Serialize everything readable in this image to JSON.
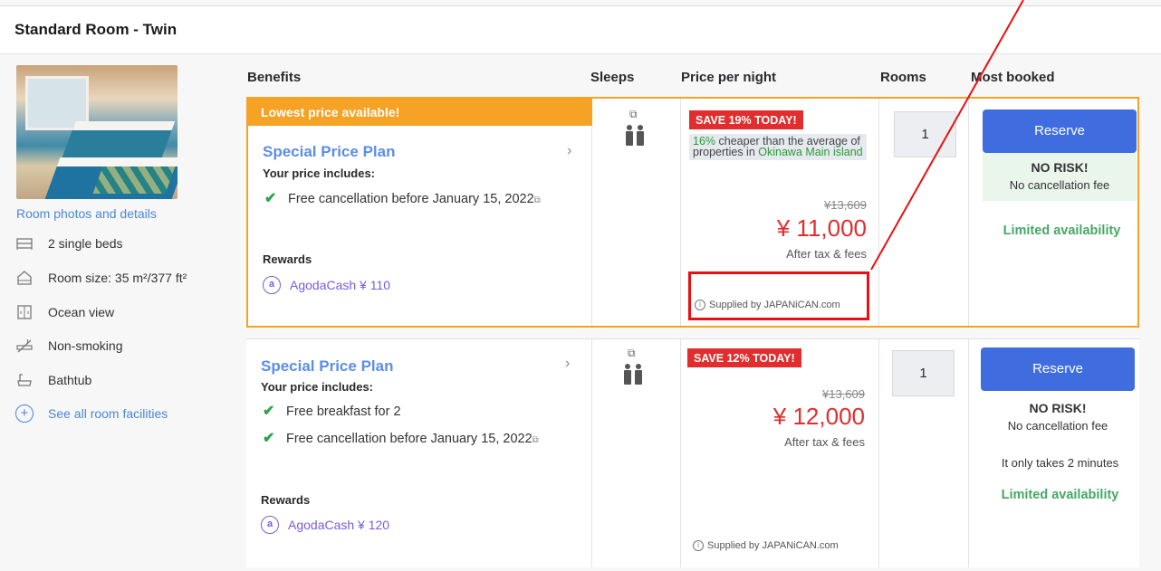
{
  "room": {
    "title": "Standard Room - Twin",
    "photo_link": "Room photos and details",
    "facilities": [
      {
        "icon": "bed-icon",
        "label": "2 single beds"
      },
      {
        "icon": "house-icon",
        "label": "Room size: 35 m²/377 ft²"
      },
      {
        "icon": "window-icon",
        "label": "Ocean view"
      },
      {
        "icon": "no-smoking-icon",
        "label": "Non-smoking"
      },
      {
        "icon": "bathtub-icon",
        "label": "Bathtub"
      }
    ],
    "see_all": "See all room facilities"
  },
  "headers": {
    "benefits": "Benefits",
    "sleeps": "Sleeps",
    "price": "Price per night",
    "rooms": "Rooms",
    "most_booked": "Most booked"
  },
  "plans": [
    {
      "ribbon": "Lowest price available!",
      "name": "Special Price Plan",
      "includes_label": "Your price includes:",
      "benefits": [
        "Free cancellation before January 15, 2022"
      ],
      "rewards_label": "Rewards",
      "rewards": "AgodaCash ¥ 110",
      "save": "SAVE 19% TODAY!",
      "cheaper_pct": "16%",
      "cheaper_text": "cheaper than the average of properties in",
      "cheaper_place": "Okinawa Main island",
      "original_price": "¥13,609",
      "price": "¥ 11,000",
      "after_tax": "After tax & fees",
      "supplied": "Supplied by JAPANiCAN.com",
      "rooms_value": "1",
      "reserve": "Reserve",
      "no_risk": "NO RISK!",
      "no_cancel": "No cancellation fee",
      "limited": "Limited availability"
    },
    {
      "name": "Special Price Plan",
      "includes_label": "Your price includes:",
      "benefits": [
        "Free breakfast for 2",
        "Free cancellation before January 15, 2022"
      ],
      "rewards_label": "Rewards",
      "rewards": "AgodaCash ¥ 120",
      "save": "SAVE 12% TODAY!",
      "original_price": "¥13,609",
      "price": "¥ 12,000",
      "after_tax": "After tax & fees",
      "supplied": "Supplied by JAPANiCAN.com",
      "rooms_value": "1",
      "reserve": "Reserve",
      "no_risk": "NO RISK!",
      "no_cancel": "No cancellation fee",
      "takes": "It only takes 2 minutes",
      "limited": "Limited availability"
    }
  ],
  "colors": {
    "accent_orange": "#f6a224",
    "price_red": "#e12d2d",
    "link_blue": "#4a87d6",
    "reserve_blue": "#3f6de0",
    "green": "#44a865"
  }
}
